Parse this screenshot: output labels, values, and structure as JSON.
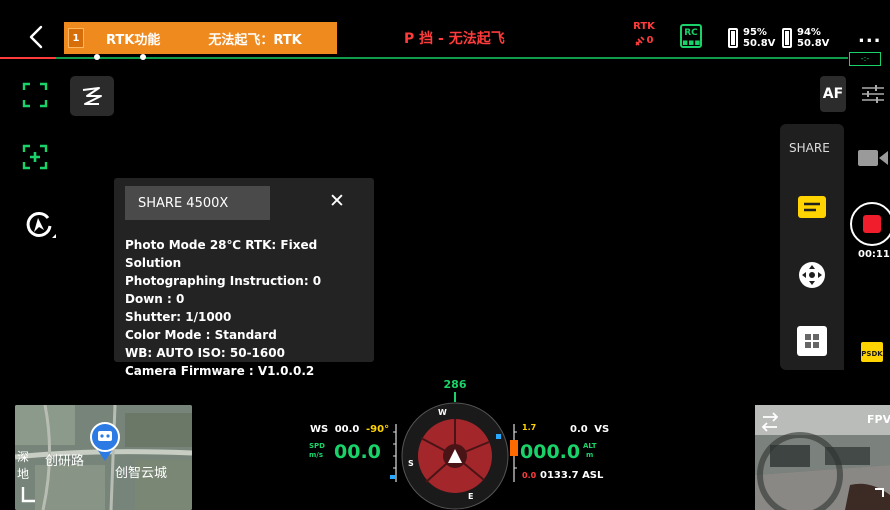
{
  "topbar": {
    "warning_count": "1",
    "warning_message": "RTK功能",
    "warning_message_2": "无法起飞：RTK",
    "gear_alert": "P 挡 - 无法起飞",
    "rtk_label": "RTK",
    "rtk_sats": "0",
    "rc_label": "RC",
    "battery_1": {
      "percent": "95%",
      "voltage": "50.8V",
      "level": 0.95
    },
    "battery_2": {
      "percent": "94%",
      "voltage": "50.8V",
      "level": 0.94
    },
    "more_label": "..."
  },
  "left_tools": [
    "frame-select-icon",
    "spotlight-center-icon",
    "smart-track-icon",
    "ai-mode-icon"
  ],
  "info_panel": {
    "title": "SHARE  4500X",
    "close_label": "✕",
    "lines": [
      "Photo Mode  28℃  RTK: Fixed Solution",
      "Photographing  Instruction: 0",
      "Down : 0",
      "Shutter: 1/1000",
      "Color Mode : Standard",
      "WB: AUTO     ISO: 50-1600",
      "Camera Firmware : V1.0.0.2"
    ]
  },
  "right_tools": {
    "af_label": "AF",
    "panel_title": "SHARE",
    "record_time": "00:11",
    "psdk_label": "PSDK"
  },
  "map": {
    "labels": [
      "创研路",
      "创智云城",
      "深",
      "地"
    ]
  },
  "flight": {
    "heading": "286",
    "ws_label": "WS",
    "ws_value": "00.0",
    "pitch": "-90°",
    "spd_label": "SPD",
    "spd_unit": "m/s",
    "speed": "00.0",
    "alt_scale_top": "1.7",
    "alt_scale_bottom": "0.0",
    "vs_value": "0.0",
    "vs_label": "VS",
    "altitude": "000.0",
    "alt_label": "ALT",
    "alt_unit": "m",
    "asl": "0133.7 ASL",
    "compass_marks": [
      "W",
      "S",
      "E"
    ]
  },
  "fpv": {
    "label": "FPV"
  },
  "colors": {
    "accent_green": "#19d36a",
    "warning_orange": "#ef8a1f",
    "alert_red": "#ff3b3b",
    "highlight_yellow": "#ffd400"
  }
}
